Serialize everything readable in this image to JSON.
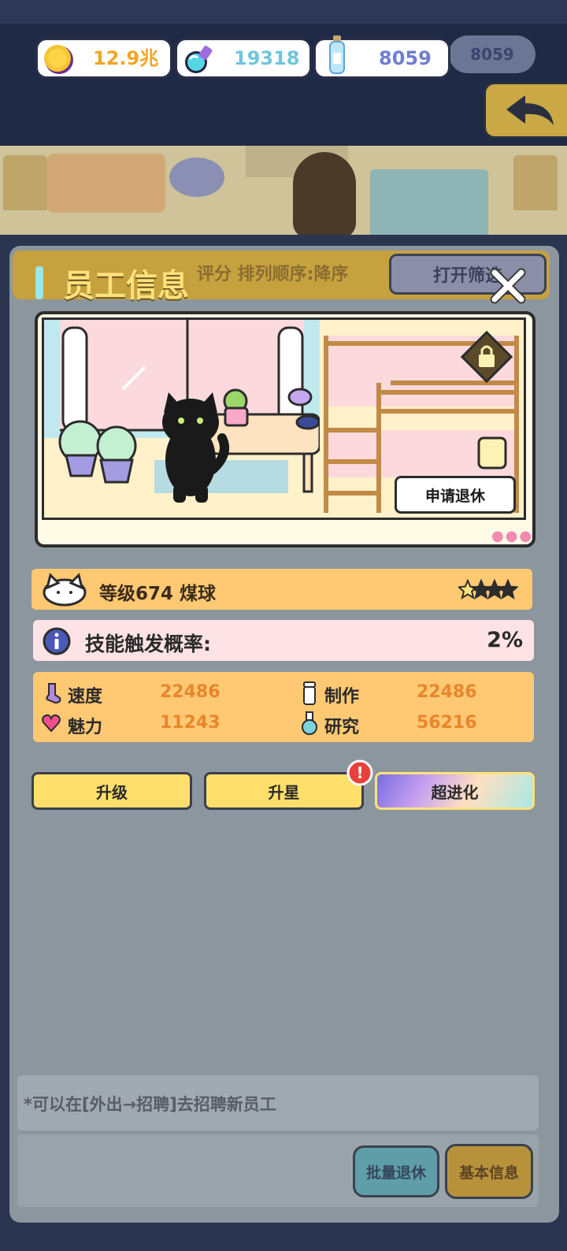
{
  "currency": {
    "coins": "12.9兆",
    "potion": "19318",
    "bottle": "8059",
    "ghost_bottle": "8059"
  },
  "background": {
    "sort_label": "评分  排列顺序:降序",
    "filter_label": "打开筛选",
    "hint": "*可以在[外出→招聘]去招聘新员工",
    "batch_retire": "批量退休",
    "basic_info": "基本信息"
  },
  "dialog": {
    "title": "员工信息",
    "retire_button": "申请退休",
    "level_text": "等级674 煤球",
    "stars": {
      "filled": 1,
      "total": 4
    },
    "skill_label": "技能触发概率:",
    "skill_value": "2%",
    "stats": [
      {
        "label": "速度",
        "value": "22486",
        "icon": "sock-icon"
      },
      {
        "label": "制作",
        "value": "22486",
        "icon": "cup-icon"
      },
      {
        "label": "魅力",
        "value": "11243",
        "icon": "heart-icon"
      },
      {
        "label": "研究",
        "value": "56216",
        "icon": "flask-icon"
      }
    ],
    "buttons": {
      "upgrade": "升级",
      "star_up": "升星",
      "evolve": "超进化"
    },
    "alert_badge": "!"
  },
  "colors": {
    "title": "#ffe27a",
    "stat_value": "#e8862a",
    "coin_value": "#f2a623",
    "potion_value": "#6fc6dc",
    "bottle_value": "#6f7fd0"
  }
}
